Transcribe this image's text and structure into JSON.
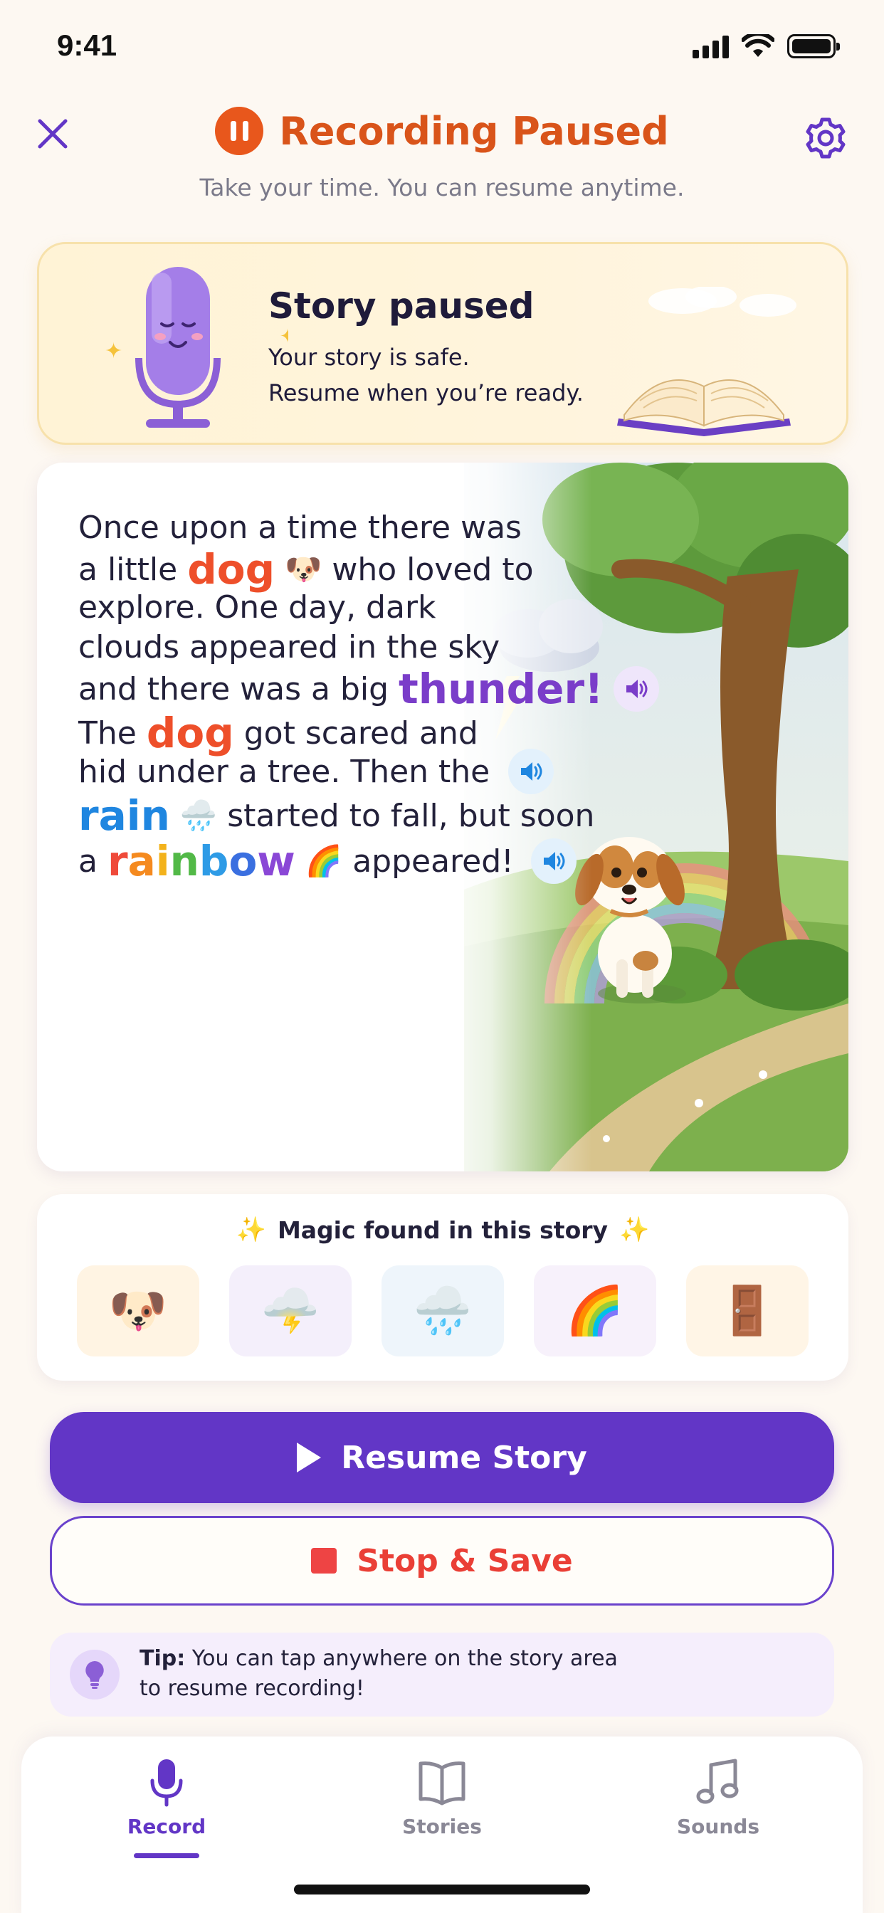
{
  "status_bar": {
    "time": "9:41"
  },
  "header": {
    "title": "Recording Paused",
    "subtitle": "Take your time. You can resume anytime."
  },
  "paused_card": {
    "title": "Story paused",
    "line1": "Your story is safe.",
    "line2": "Resume when you’re ready."
  },
  "story": {
    "lines": [
      {
        "text": "Once upon a time there was"
      },
      {
        "pre": "a little",
        "keyword": "dog",
        "emoji": "🐶",
        "post": "who loved to"
      },
      {
        "text": "explore. One day, dark"
      },
      {
        "text": "clouds appeared in the sky"
      },
      {
        "pre": "and there was a big",
        "keyword": "thunder!"
      },
      {
        "pre": "The",
        "keyword": "dog",
        "post": "got scared and"
      },
      {
        "text": "hid under a tree. Then the"
      },
      {
        "keyword": "rain",
        "emoji": "🌧️",
        "post": "started to fall, but soon"
      },
      {
        "pre": "a",
        "keyword": "rainbow",
        "emoji": "🌈",
        "post": "appeared!"
      }
    ],
    "rainbow_letters": [
      "r",
      "a",
      "i",
      "n",
      "b",
      "o",
      "w"
    ],
    "rainbow_colors": [
      "#ef4a3a",
      "#f58a1f",
      "#f3b21b",
      "#52b947",
      "#2e9be6",
      "#3a6fe0",
      "#8a47d6"
    ]
  },
  "magic": {
    "title": "Magic found in this story",
    "sparkle": "✨",
    "items": [
      {
        "emoji": "🐶",
        "icon": "dog-icon",
        "bg": "#fff4e3"
      },
      {
        "emoji": "🌩️",
        "icon": "thunder-cloud-icon",
        "bg": "#f4effb"
      },
      {
        "emoji": "🌧️",
        "icon": "rain-cloud-icon",
        "bg": "#eef5fb"
      },
      {
        "emoji": "🌈",
        "icon": "rainbow-icon",
        "bg": "#f7f1fb"
      },
      {
        "emoji": "🚪",
        "icon": "magic-door-icon",
        "bg": "#fff5e6"
      }
    ]
  },
  "actions": {
    "resume_label": "Resume Story",
    "stop_label": "Stop & Save"
  },
  "tip": {
    "prefix": "Tip:",
    "line1": "You can tap anywhere on the story area",
    "line2": "to resume recording!"
  },
  "tabs": [
    {
      "label": "Record",
      "icon": "microphone-icon",
      "active": true
    },
    {
      "label": "Stories",
      "icon": "book-icon",
      "active": false
    },
    {
      "label": "Sounds",
      "icon": "music-note-icon",
      "active": false
    }
  ],
  "colors": {
    "primary": "#6236c6",
    "accent_orange": "#d9541a",
    "stop_red": "#ea3f36",
    "background": "#fdf8f2"
  }
}
